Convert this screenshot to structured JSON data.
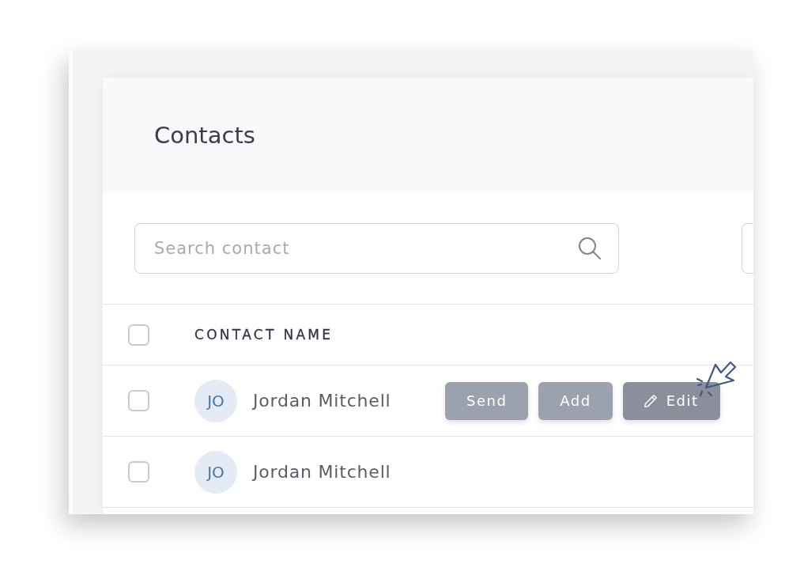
{
  "page": {
    "title": "Contacts"
  },
  "search": {
    "placeholder": "Search contact"
  },
  "table": {
    "select_all": {
      "checked": false
    },
    "columns": [
      "CONTACT NAME"
    ],
    "rows": [
      {
        "initials": "JO",
        "name": "Jordan Mitchell",
        "checked": false,
        "actions": [
          {
            "kind": "text",
            "label": "Send",
            "hovered": false
          },
          {
            "kind": "text",
            "label": "Add",
            "hovered": false
          },
          {
            "kind": "icon",
            "label": "Edit",
            "hovered": true
          }
        ]
      },
      {
        "initials": "JO",
        "name": "Jordan Mitchell",
        "checked": false
      }
    ]
  }
}
